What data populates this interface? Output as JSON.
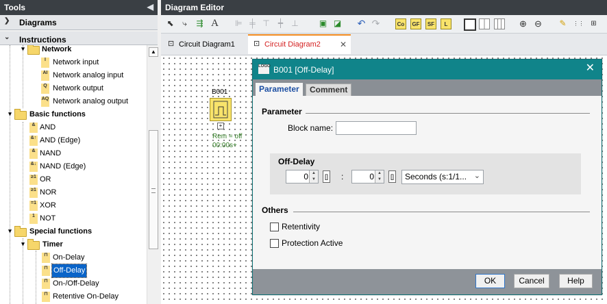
{
  "tools": {
    "title": "Tools",
    "diagrams_label": "Diagrams",
    "instructions_label": "Instructions"
  },
  "tree": {
    "network": "Network",
    "network_items": [
      "Network input",
      "Network analog input",
      "Network output",
      "Network analog output"
    ],
    "network_icons": [
      "I",
      "AI",
      "Q",
      "AQ"
    ],
    "basic": "Basic functions",
    "basic_items": [
      "AND",
      "AND (Edge)",
      "NAND",
      "NAND (Edge)",
      "OR",
      "NOR",
      "XOR",
      "NOT"
    ],
    "basic_icons": [
      "&",
      "&↑",
      "&",
      "&↓",
      "≥1",
      "≥1",
      "=1",
      "1"
    ],
    "special": "Special functions",
    "timer": "Timer",
    "timer_items": [
      "On-Delay",
      "Off-Delay",
      "On-/Off-Delay",
      "Retentive On-Delay"
    ],
    "selected": "Off-Delay"
  },
  "editor": {
    "title": "Diagram Editor",
    "toolbar_letters": [
      "Co",
      "GF",
      "SF",
      "L"
    ],
    "tabs": [
      "Circuit Diagram1",
      "Circuit Diagram2"
    ],
    "active_tab": "Circuit Diagram2"
  },
  "block": {
    "name": "B001",
    "rem": "Rem = off",
    "time": "00:00s+"
  },
  "dialog": {
    "logo_text": "LOGO",
    "title": "B001 [Off-Delay]",
    "tabs": [
      "Parameter",
      "Comment"
    ],
    "parameter_group": "Parameter",
    "block_name_label": "Block name:",
    "block_name_value": "",
    "offdelay_group": "Off-Delay",
    "value1": "0",
    "separator": ":",
    "value2": "0",
    "unit": "Seconds (s:1/1...",
    "others_group": "Others",
    "retentivity": "Retentivity",
    "protection": "Protection Active",
    "buttons": {
      "ok": "OK",
      "cancel": "Cancel",
      "help": "Help"
    }
  },
  "colors": {
    "accent_teal": "#10848a",
    "block_yellow": "#f8e36b",
    "selection_blue": "#0a64c8",
    "active_tab_red": "#d42020"
  }
}
